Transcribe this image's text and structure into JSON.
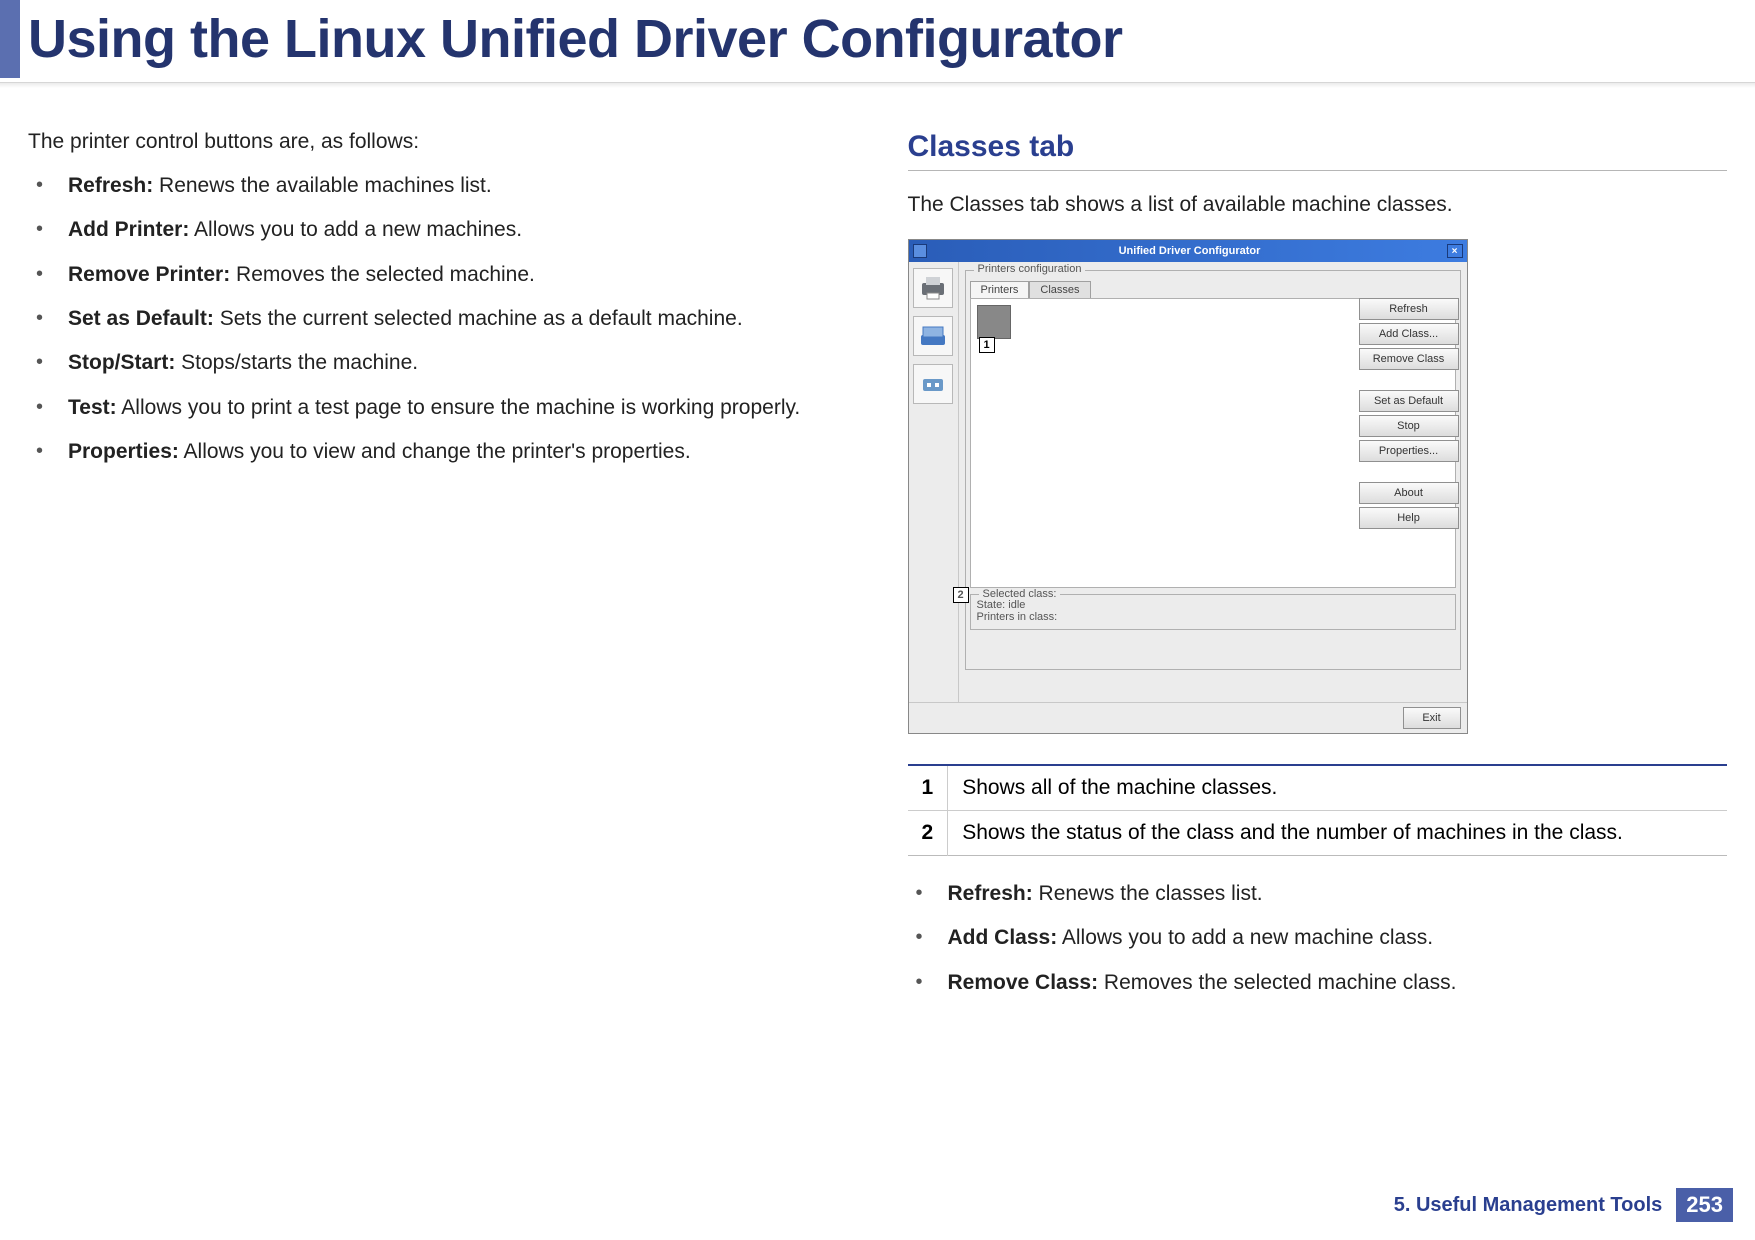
{
  "page": {
    "title": "Using the Linux Unified Driver Configurator",
    "footer_chapter": "5.  Useful Management Tools",
    "page_number": "253"
  },
  "left": {
    "intro": "The printer control buttons are, as follows:",
    "items": [
      {
        "term": "Refresh:",
        "desc": " Renews the available machines list."
      },
      {
        "term": "Add Printer:",
        "desc": " Allows you to add a new machines."
      },
      {
        "term": "Remove Printer:",
        "desc": " Removes the selected machine."
      },
      {
        "term": "Set as Default:",
        "desc": " Sets the current selected machine as a default machine."
      },
      {
        "term": "Stop/Start:",
        "desc": " Stops/starts the machine."
      },
      {
        "term": "Test:",
        "desc": " Allows you to print a test page to ensure the machine is working properly."
      },
      {
        "term": "Properties:",
        "desc": " Allows you to view and change the printer's properties."
      }
    ]
  },
  "right": {
    "heading": "Classes tab",
    "intro": "The Classes tab shows a list of available machine classes.",
    "window": {
      "title": "Unified Driver Configurator",
      "fieldset_legend": "Printers configuration",
      "tabs": {
        "printers": "Printers",
        "classes": "Classes"
      },
      "buttons": {
        "refresh": "Refresh",
        "add_class": "Add Class...",
        "remove_class": "Remove Class",
        "set_default": "Set as Default",
        "stop": "Stop",
        "properties": "Properties...",
        "about": "About",
        "help": "Help",
        "exit": "Exit"
      },
      "selected": {
        "legend": "Selected class:",
        "state_label": "State: ",
        "state_value": "idle",
        "printers_label": "Printers in class:"
      },
      "callouts": {
        "c1": "1",
        "c2": "2"
      }
    },
    "table": {
      "rows": [
        {
          "num": "1",
          "desc": "Shows all of the machine classes."
        },
        {
          "num": "2",
          "desc": "Shows the status of the class and the number of machines in the class."
        }
      ]
    },
    "bullets": [
      {
        "term": "Refresh:",
        "desc": " Renews the classes list."
      },
      {
        "term": "Add Class:",
        "desc": " Allows you to add a new machine class."
      },
      {
        "term": "Remove Class:",
        "desc": " Removes the selected machine class."
      }
    ]
  }
}
